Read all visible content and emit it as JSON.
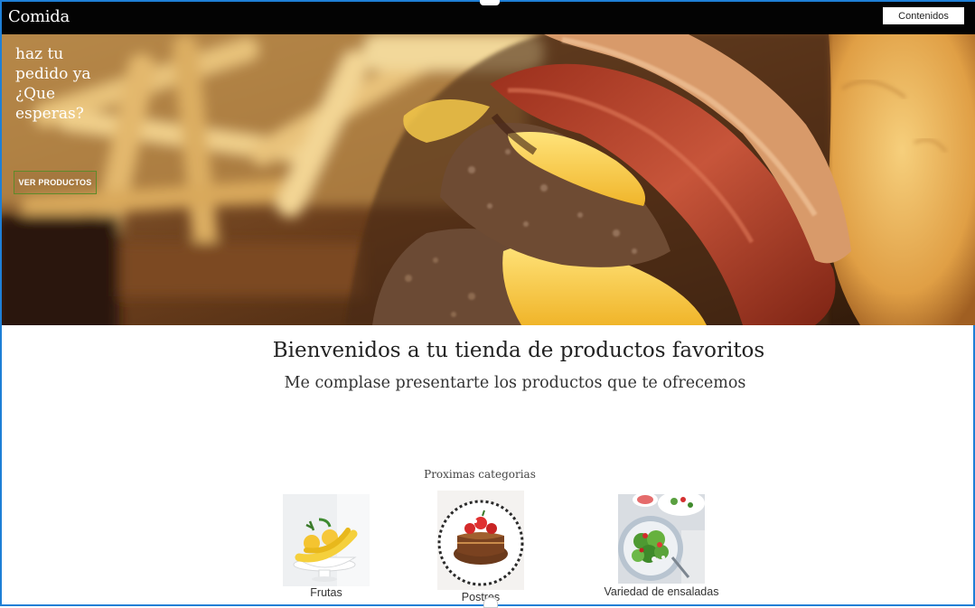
{
  "header": {
    "brand": "Comida",
    "contents_button": "Contenidos"
  },
  "hero": {
    "title": "haz tu pedido ya ¿Que esperas?",
    "button": "VER PRODUCTOS",
    "image": "burger-and-fries-photo"
  },
  "welcome": {
    "title": "Bienvenidos a tu tienda de productos favoritos",
    "subtitle": "Me complase presentarte los productos que te ofrecemos"
  },
  "categories": {
    "label": "Proximas categorias",
    "items": [
      {
        "name": "Frutas",
        "image": "fruit-bowl-photo"
      },
      {
        "name": "Postres",
        "image": "dessert-cake-photo"
      },
      {
        "name": "Variedad de ensaladas",
        "image": "salad-bowl-photo"
      }
    ]
  },
  "colors": {
    "topbar": "#030303",
    "hero_button_border": "#5d8b2a",
    "frame": "#1e7fd6"
  }
}
